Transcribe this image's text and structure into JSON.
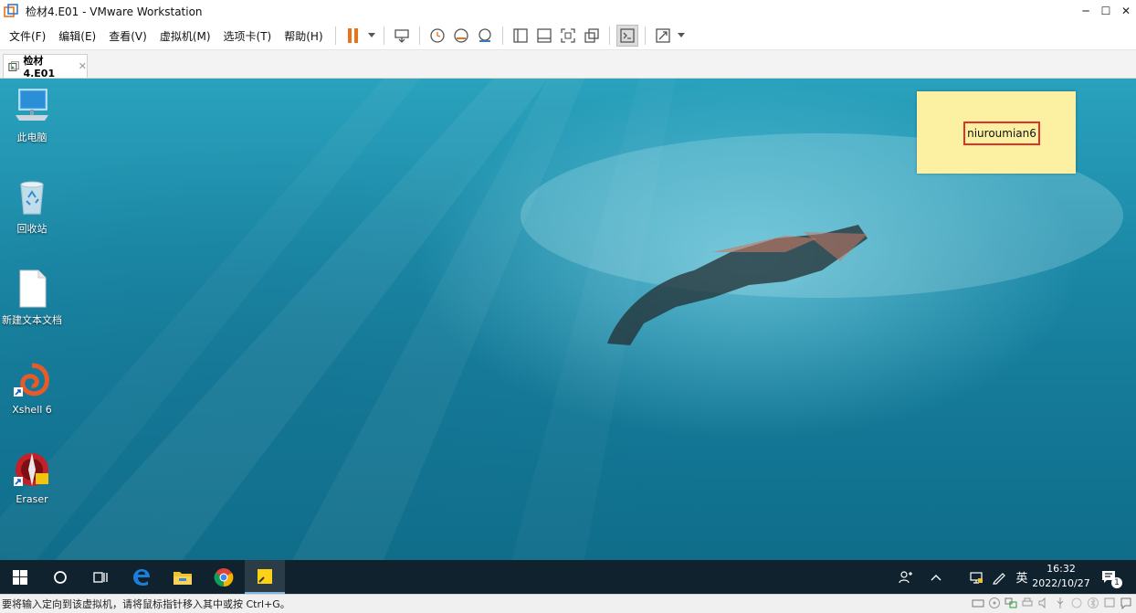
{
  "window": {
    "title": "检材4.E01 - VMware Workstation",
    "controls": {
      "minimize": "─",
      "maximize": "☐",
      "close": "✕"
    }
  },
  "menu": {
    "items": [
      "文件(F)",
      "编辑(E)",
      "查看(V)",
      "虚拟机(M)",
      "选项卡(T)",
      "帮助(H)"
    ]
  },
  "toolbar": {
    "buttons": [
      "pause",
      "send-ctrl-alt-del",
      "snapshot",
      "revert-snapshot",
      "snapshot-manager",
      "view-library",
      "view-thumbnail",
      "fullscreen",
      "unity",
      "console",
      "stretch"
    ],
    "accent": "#e8731c"
  },
  "tabs": [
    {
      "label": "检材4.E01",
      "close": "✕"
    }
  ],
  "desktop": {
    "icons": [
      {
        "name": "此电脑",
        "icon": "computer-icon"
      },
      {
        "name": "回收站",
        "icon": "recycle-bin-icon"
      },
      {
        "name": "新建文本文档",
        "icon": "text-document-icon"
      },
      {
        "name": "Xshell 6",
        "icon": "xshell-icon"
      },
      {
        "name": "Eraser",
        "icon": "eraser-icon"
      }
    ],
    "sticky_note": {
      "text": "niuroumian6",
      "highlight_color": "#e0302a",
      "background": "#fcf0a2"
    }
  },
  "taskbar": {
    "pinned": [
      "start-icon",
      "search-icon",
      "task-view-icon",
      "edge-icon",
      "file-explorer-icon",
      "chrome-icon",
      "sticky-notes-icon"
    ],
    "tray": {
      "ime": "英",
      "time": "16:32",
      "date": "2022/10/27",
      "notification_count": "1"
    }
  },
  "statusbar": {
    "message": "要将输入定向到该虚拟机，请将鼠标指针移入其中或按 Ctrl+G。"
  }
}
